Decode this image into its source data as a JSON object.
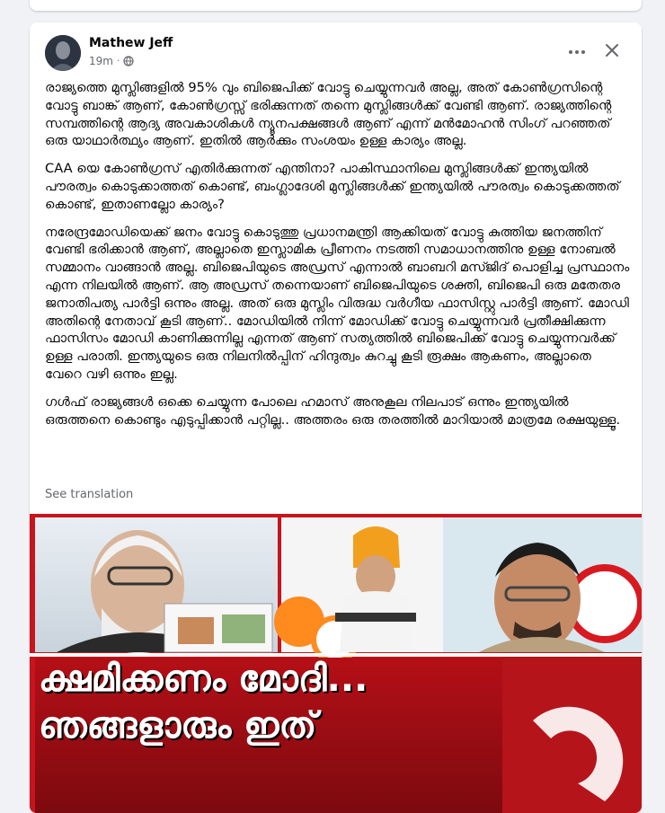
{
  "post": {
    "author": "Mathew Jeff",
    "time": "19m",
    "audience_icon": "globe-icon",
    "more_icon": "more-horizontal-icon",
    "close_icon": "close-icon",
    "paragraphs": [
      "രാജ്യത്തെ മുസ്ലിങ്ങളിൽ 95% വും ബിജെപിക്ക് വോട്ടു ചെയ്യുന്നവർ അല്ല, അത് കോൺഗ്രസിന്റെ വോട്ടു ബാങ്ക് ആണ്, കോൺഗ്രസ്സ് ഭരിക്കുന്നത് തന്നെ മുസ്ലിങ്ങൾക്ക് വേണ്ടി ആണ്. രാജ്യത്തിന്റെ സമ്പത്തിന്റെ ആദ്യ അവകാശികൾ ന്യൂനപക്ഷങ്ങൾ ആണ് എന്ന് മൻമോഹൻ സിംഗ് പറഞ്ഞത് ഒരു യാഥാർത്ഥ്യം ആണ്. ഇതിൽ ആർക്കും സംശയം ഉള്ള കാര്യം അല്ല.",
      "CAA യെ കോൺഗ്രസ് എതിർക്കുന്നത് എന്തിനാ? പാകിസ്ഥാനിലെ മുസ്ലിങ്ങൾക്ക് ഇന്ത്യയിൽ പൗരത്വം കൊടുക്കാത്തത് കൊണ്ട്, ബംഗ്ലാദേശി മുസ്ലിങ്ങൾക്ക് ഇന്ത്യയിൽ പൗരത്വം കൊടുക്കത്തത് കൊണ്ട്, ഇതാണല്ലോ കാര്യം?",
      "നരേന്ദ്രമോഡിയെക്ക് ജനം വോട്ടു കൊടുത്തു പ്രധാനമന്ത്രി ആക്കിയത് വോട്ടു കുത്തിയ ജനത്തിന് വേണ്ടി ഭരിക്കാൻ ആണ്, അല്ലാതെ ഇസ്ലാമിക പ്രീണനം നടത്തി സമാധാനത്തിനു ഉള്ള നോബൽ സമ്മാനം വാങ്ങാൻ അല്ല. ബിജെപിയുടെ അഡ്രസ് എന്നാൽ ബാബറി മസ്ജിദ് പൊളിച്ച പ്രസ്ഥാനം എന്ന നിലയിൽ ആണ്. ആ അഡ്രസ് തന്നെയാണ് ബിജെപിയുടെ ശക്തി, ബിജെപി ഒരു മതേതര ജനാതിപത്യ പാർട്ടി ഒന്നും അല്ല. അത് ഒരു മുസ്ലിം വിരുദ്ധ വർഗീയ ഫാസിസ്റ്റു പാർട്ടി ആണ്. മോഡി അതിന്റെ നേതാവ് കൂടി ആണ്.. മോഡിയിൽ നിന്ന് മോഡിക്ക് വോട്ടു ചെയ്യുന്നവർ പ്രതീക്ഷിക്കുന്ന ഫാസിസം മോഡി കാണിക്കുന്നില്ല എന്നത് ആണ് സത്യത്തിൽ ബിജെപിക്ക് വോട്ടു ചെയ്യുന്നവർക്ക് ഉള്ള പരാതി. ഇന്ത്യയുടെ ഒരു നിലനിൽപ്പിന് ഹിന്ദുത്വം കുറച്ചു കൂടി രൂക്ഷം ആകണം, അല്ലാതെ വേറെ വഴി ഒന്നും ഇല്ല.",
      "ഗൾഫ് രാജ്യങ്ങൾ ഒക്കെ ചെയ്യുന്ന പോലെ ഹമാസ് അനുകൂല നിലപാട് ഒന്നും ഇന്ത്യയിൽ ഒരുത്തനെ കൊണ്ടും എടുപ്പിക്കാൻ പറ്റില്ല.. അത്തരം ഒരു തരത്തിൽ മാറിയാൽ മാത്രമേ രക്ഷയുള്ളൂ."
    ],
    "see_translation": "See translation",
    "thumbnail": {
      "headline_line1": "ക്ഷമിക്കണം മോദി...",
      "headline_line2": "ഞങ്ങളാരും ഇത്",
      "accent_color": "#d71920"
    }
  },
  "colors": {
    "page_bg": "#f0f2f5",
    "card_bg": "#ffffff",
    "secondary_text": "#65676b"
  }
}
